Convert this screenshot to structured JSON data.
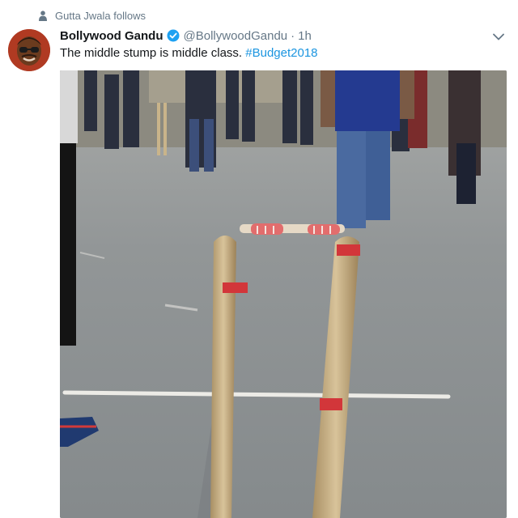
{
  "social_context": {
    "icon": "person-icon",
    "text": "Gutta Jwala follows"
  },
  "author": {
    "display_name": "Bollywood Gandu",
    "handle": "@BollywoodGandu",
    "separator": "·",
    "timestamp": "1h",
    "verified_icon": "verified-badge-icon",
    "verified_color": "#1da1f2",
    "avatar_bg": "#b03a22"
  },
  "tweet": {
    "text": "The middle stump is middle class. ",
    "hashtag": "#Budget2018",
    "hashtag_color": "#1b95e0"
  },
  "menu": {
    "icon": "chevron-down-icon"
  }
}
